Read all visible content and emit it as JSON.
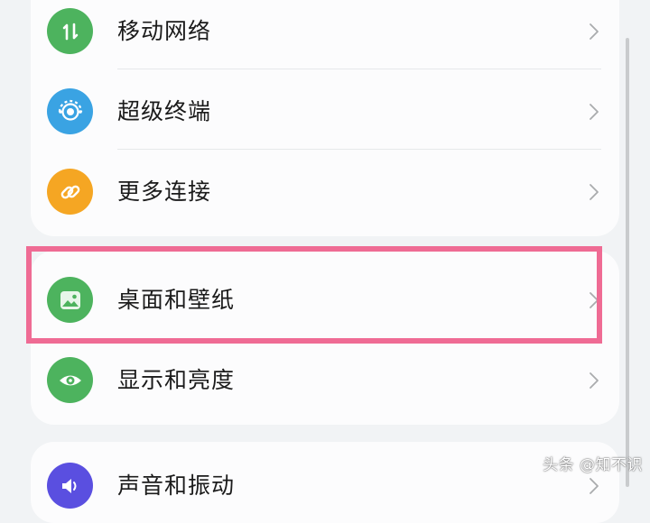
{
  "settings": {
    "group1": [
      {
        "label": "移动网络",
        "icon": "mobile-network-icon",
        "icon_color": "#4db35e"
      },
      {
        "label": "超级终端",
        "icon": "super-device-icon",
        "icon_color": "#3aa3e3"
      },
      {
        "label": "更多连接",
        "icon": "link-icon",
        "icon_color": "#f5a623"
      }
    ],
    "group2": [
      {
        "label": "桌面和壁纸",
        "icon": "wallpaper-icon",
        "icon_color": "#4db35e"
      },
      {
        "label": "显示和亮度",
        "icon": "eye-icon",
        "icon_color": "#4db35e"
      }
    ],
    "group3": [
      {
        "label": "声音和振动",
        "icon": "sound-icon",
        "icon_color": "#5a4fe0"
      }
    ]
  },
  "highlight_color": "#ef6b94",
  "watermark": "头条 @知不识"
}
